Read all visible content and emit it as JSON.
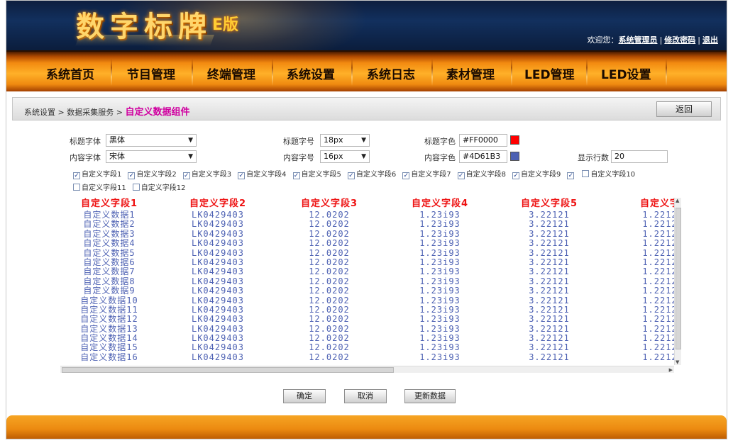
{
  "app": {
    "logo": "数字标牌",
    "version": "E版",
    "welcome_prefix": "欢迎您：",
    "user": "系统管理员",
    "change_password": "修改密码",
    "logout": "退出"
  },
  "nav": [
    "系统首页",
    "节目管理",
    "终端管理",
    "系统设置",
    "系统日志",
    "素材管理",
    "LED管理",
    "LED设置"
  ],
  "breadcrumb": {
    "root": "系统设置",
    "parent": "数据采集服务",
    "current": "自定义数据组件"
  },
  "back_label": "返回",
  "settings": {
    "title_font_label": "标题字体",
    "title_font_value": "黑体",
    "title_size_label": "标题字号",
    "title_size_value": "18px",
    "title_color_label": "标题字色",
    "title_color_value": "#FF0000",
    "content_font_label": "内容字体",
    "content_font_value": "宋体",
    "content_size_label": "内容字号",
    "content_size_value": "16px",
    "content_color_label": "内容字色",
    "content_color_value": "#4D61B3",
    "rows_label": "显示行数",
    "rows_value": "20"
  },
  "fields": [
    {
      "label": "自定义字段1",
      "checked": true
    },
    {
      "label": "自定义字段2",
      "checked": true
    },
    {
      "label": "自定义字段3",
      "checked": true
    },
    {
      "label": "自定义字段4",
      "checked": true
    },
    {
      "label": "自定义字段5",
      "checked": true
    },
    {
      "label": "自定义字段6",
      "checked": true
    },
    {
      "label": "自定义字段7",
      "checked": true
    },
    {
      "label": "自定义字段8",
      "checked": true
    },
    {
      "label": "自定义字段9",
      "checked": true
    },
    {
      "label": "",
      "checked": true
    },
    {
      "label": "自定义字段10",
      "checked": false
    },
    {
      "label": "自定义字段11",
      "checked": false
    },
    {
      "label": "自定义字段12",
      "checked": false
    }
  ],
  "preview": {
    "headers": [
      "自定义字段1",
      "自定义字段2",
      "自定义字段3",
      "自定义字段4",
      "自定义字段5",
      "自定义字"
    ],
    "columns": [
      [
        "自定义数据1",
        "自定义数据2",
        "自定义数据3",
        "自定义数据4",
        "自定义数据5",
        "自定义数据6",
        "自定义数据7",
        "自定义数据8",
        "自定义数据9",
        "自定义数据10",
        "自定义数据11",
        "自定义数据12",
        "自定义数据13",
        "自定义数据14",
        "自定义数据15",
        "自定义数据16"
      ],
      [
        "LK0429403",
        "LK0429403",
        "LK0429403",
        "LK0429403",
        "LK0429403",
        "LK0429403",
        "LK0429403",
        "LK0429403",
        "LK0429403",
        "LK0429403",
        "LK0429403",
        "LK0429403",
        "LK0429403",
        "LK0429403",
        "LK0429403",
        "LK0429403"
      ],
      [
        "12.0202",
        "12.0202",
        "12.0202",
        "12.0202",
        "12.0202",
        "12.0202",
        "12.0202",
        "12.0202",
        "12.0202",
        "12.0202",
        "12.0202",
        "12.0202",
        "12.0202",
        "12.0202",
        "12.0202",
        "12.0202"
      ],
      [
        "1.23i93",
        "1.23i93",
        "1.23i93",
        "1.23i93",
        "1.23i93",
        "1.23i93",
        "1.23i93",
        "1.23i93",
        "1.23i93",
        "1.23i93",
        "1.23i93",
        "1.23i93",
        "1.23i93",
        "1.23i93",
        "1.23i93",
        "1.23i93"
      ],
      [
        "3.22121",
        "3.22121",
        "3.22121",
        "3.22121",
        "3.22121",
        "3.22121",
        "3.22121",
        "3.22121",
        "3.22121",
        "3.22121",
        "3.22121",
        "3.22121",
        "3.22121",
        "3.22121",
        "3.22121",
        "3.22121"
      ],
      [
        "1.2212",
        "1.2212",
        "1.2212",
        "1.2212",
        "1.2212",
        "1.2212",
        "1.2212",
        "1.2212",
        "1.2212",
        "1.2212",
        "1.2212",
        "1.2212",
        "1.2212",
        "1.2212",
        "1.2212",
        "1.2212"
      ]
    ]
  },
  "buttons": {
    "confirm": "确定",
    "cancel": "取消",
    "refresh": "更新数据"
  },
  "colors": {
    "title_swatch": "#FF0000",
    "content_swatch": "#4D61B3"
  }
}
